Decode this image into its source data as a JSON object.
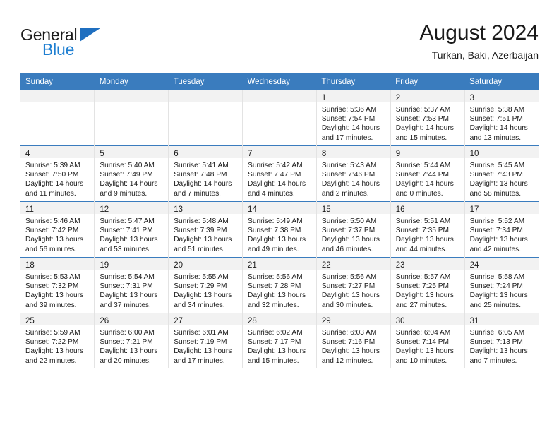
{
  "brand": {
    "line1": "General",
    "line2": "Blue",
    "flag_color": "#1f6fc0",
    "blue_color": "#1f7fd1"
  },
  "header": {
    "month_title": "August 2024",
    "location": "Turkan, Baki, Azerbaijan"
  },
  "theme": {
    "header_row_bg": "#3a7cbe",
    "daynum_band_bg": "#f2f2f2",
    "grid_line": "#3a7cbe",
    "text": "#1a1a1a"
  },
  "weekday_headers": [
    "Sunday",
    "Monday",
    "Tuesday",
    "Wednesday",
    "Thursday",
    "Friday",
    "Saturday"
  ],
  "weeks": [
    [
      {
        "day": "",
        "sunrise": "",
        "sunset": "",
        "daylight_1": "",
        "daylight_2": ""
      },
      {
        "day": "",
        "sunrise": "",
        "sunset": "",
        "daylight_1": "",
        "daylight_2": ""
      },
      {
        "day": "",
        "sunrise": "",
        "sunset": "",
        "daylight_1": "",
        "daylight_2": ""
      },
      {
        "day": "",
        "sunrise": "",
        "sunset": "",
        "daylight_1": "",
        "daylight_2": ""
      },
      {
        "day": "1",
        "sunrise": "Sunrise: 5:36 AM",
        "sunset": "Sunset: 7:54 PM",
        "daylight_1": "Daylight: 14 hours",
        "daylight_2": "and 17 minutes."
      },
      {
        "day": "2",
        "sunrise": "Sunrise: 5:37 AM",
        "sunset": "Sunset: 7:53 PM",
        "daylight_1": "Daylight: 14 hours",
        "daylight_2": "and 15 minutes."
      },
      {
        "day": "3",
        "sunrise": "Sunrise: 5:38 AM",
        "sunset": "Sunset: 7:51 PM",
        "daylight_1": "Daylight: 14 hours",
        "daylight_2": "and 13 minutes."
      }
    ],
    [
      {
        "day": "4",
        "sunrise": "Sunrise: 5:39 AM",
        "sunset": "Sunset: 7:50 PM",
        "daylight_1": "Daylight: 14 hours",
        "daylight_2": "and 11 minutes."
      },
      {
        "day": "5",
        "sunrise": "Sunrise: 5:40 AM",
        "sunset": "Sunset: 7:49 PM",
        "daylight_1": "Daylight: 14 hours",
        "daylight_2": "and 9 minutes."
      },
      {
        "day": "6",
        "sunrise": "Sunrise: 5:41 AM",
        "sunset": "Sunset: 7:48 PM",
        "daylight_1": "Daylight: 14 hours",
        "daylight_2": "and 7 minutes."
      },
      {
        "day": "7",
        "sunrise": "Sunrise: 5:42 AM",
        "sunset": "Sunset: 7:47 PM",
        "daylight_1": "Daylight: 14 hours",
        "daylight_2": "and 4 minutes."
      },
      {
        "day": "8",
        "sunrise": "Sunrise: 5:43 AM",
        "sunset": "Sunset: 7:46 PM",
        "daylight_1": "Daylight: 14 hours",
        "daylight_2": "and 2 minutes."
      },
      {
        "day": "9",
        "sunrise": "Sunrise: 5:44 AM",
        "sunset": "Sunset: 7:44 PM",
        "daylight_1": "Daylight: 14 hours",
        "daylight_2": "and 0 minutes."
      },
      {
        "day": "10",
        "sunrise": "Sunrise: 5:45 AM",
        "sunset": "Sunset: 7:43 PM",
        "daylight_1": "Daylight: 13 hours",
        "daylight_2": "and 58 minutes."
      }
    ],
    [
      {
        "day": "11",
        "sunrise": "Sunrise: 5:46 AM",
        "sunset": "Sunset: 7:42 PM",
        "daylight_1": "Daylight: 13 hours",
        "daylight_2": "and 56 minutes."
      },
      {
        "day": "12",
        "sunrise": "Sunrise: 5:47 AM",
        "sunset": "Sunset: 7:41 PM",
        "daylight_1": "Daylight: 13 hours",
        "daylight_2": "and 53 minutes."
      },
      {
        "day": "13",
        "sunrise": "Sunrise: 5:48 AM",
        "sunset": "Sunset: 7:39 PM",
        "daylight_1": "Daylight: 13 hours",
        "daylight_2": "and 51 minutes."
      },
      {
        "day": "14",
        "sunrise": "Sunrise: 5:49 AM",
        "sunset": "Sunset: 7:38 PM",
        "daylight_1": "Daylight: 13 hours",
        "daylight_2": "and 49 minutes."
      },
      {
        "day": "15",
        "sunrise": "Sunrise: 5:50 AM",
        "sunset": "Sunset: 7:37 PM",
        "daylight_1": "Daylight: 13 hours",
        "daylight_2": "and 46 minutes."
      },
      {
        "day": "16",
        "sunrise": "Sunrise: 5:51 AM",
        "sunset": "Sunset: 7:35 PM",
        "daylight_1": "Daylight: 13 hours",
        "daylight_2": "and 44 minutes."
      },
      {
        "day": "17",
        "sunrise": "Sunrise: 5:52 AM",
        "sunset": "Sunset: 7:34 PM",
        "daylight_1": "Daylight: 13 hours",
        "daylight_2": "and 42 minutes."
      }
    ],
    [
      {
        "day": "18",
        "sunrise": "Sunrise: 5:53 AM",
        "sunset": "Sunset: 7:32 PM",
        "daylight_1": "Daylight: 13 hours",
        "daylight_2": "and 39 minutes."
      },
      {
        "day": "19",
        "sunrise": "Sunrise: 5:54 AM",
        "sunset": "Sunset: 7:31 PM",
        "daylight_1": "Daylight: 13 hours",
        "daylight_2": "and 37 minutes."
      },
      {
        "day": "20",
        "sunrise": "Sunrise: 5:55 AM",
        "sunset": "Sunset: 7:29 PM",
        "daylight_1": "Daylight: 13 hours",
        "daylight_2": "and 34 minutes."
      },
      {
        "day": "21",
        "sunrise": "Sunrise: 5:56 AM",
        "sunset": "Sunset: 7:28 PM",
        "daylight_1": "Daylight: 13 hours",
        "daylight_2": "and 32 minutes."
      },
      {
        "day": "22",
        "sunrise": "Sunrise: 5:56 AM",
        "sunset": "Sunset: 7:27 PM",
        "daylight_1": "Daylight: 13 hours",
        "daylight_2": "and 30 minutes."
      },
      {
        "day": "23",
        "sunrise": "Sunrise: 5:57 AM",
        "sunset": "Sunset: 7:25 PM",
        "daylight_1": "Daylight: 13 hours",
        "daylight_2": "and 27 minutes."
      },
      {
        "day": "24",
        "sunrise": "Sunrise: 5:58 AM",
        "sunset": "Sunset: 7:24 PM",
        "daylight_1": "Daylight: 13 hours",
        "daylight_2": "and 25 minutes."
      }
    ],
    [
      {
        "day": "25",
        "sunrise": "Sunrise: 5:59 AM",
        "sunset": "Sunset: 7:22 PM",
        "daylight_1": "Daylight: 13 hours",
        "daylight_2": "and 22 minutes."
      },
      {
        "day": "26",
        "sunrise": "Sunrise: 6:00 AM",
        "sunset": "Sunset: 7:21 PM",
        "daylight_1": "Daylight: 13 hours",
        "daylight_2": "and 20 minutes."
      },
      {
        "day": "27",
        "sunrise": "Sunrise: 6:01 AM",
        "sunset": "Sunset: 7:19 PM",
        "daylight_1": "Daylight: 13 hours",
        "daylight_2": "and 17 minutes."
      },
      {
        "day": "28",
        "sunrise": "Sunrise: 6:02 AM",
        "sunset": "Sunset: 7:17 PM",
        "daylight_1": "Daylight: 13 hours",
        "daylight_2": "and 15 minutes."
      },
      {
        "day": "29",
        "sunrise": "Sunrise: 6:03 AM",
        "sunset": "Sunset: 7:16 PM",
        "daylight_1": "Daylight: 13 hours",
        "daylight_2": "and 12 minutes."
      },
      {
        "day": "30",
        "sunrise": "Sunrise: 6:04 AM",
        "sunset": "Sunset: 7:14 PM",
        "daylight_1": "Daylight: 13 hours",
        "daylight_2": "and 10 minutes."
      },
      {
        "day": "31",
        "sunrise": "Sunrise: 6:05 AM",
        "sunset": "Sunset: 7:13 PM",
        "daylight_1": "Daylight: 13 hours",
        "daylight_2": "and 7 minutes."
      }
    ]
  ]
}
